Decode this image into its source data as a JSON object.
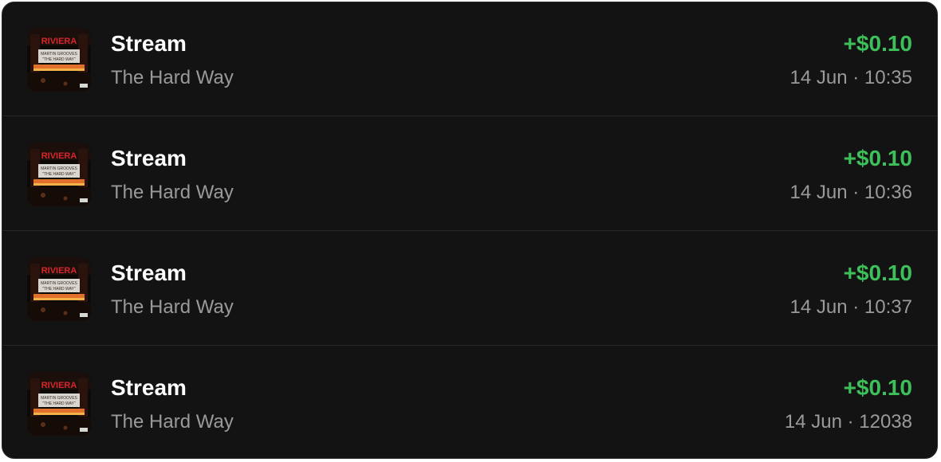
{
  "transactions": [
    {
      "title": "Stream",
      "subtitle": "The Hard Way",
      "amount": "+$0.10",
      "time": "14 Jun · 10:35",
      "artwork": {
        "marquee_top": "RIVIERA",
        "line1": "MARTIN GROOVES",
        "line2": "\"THE HARD WAY\""
      }
    },
    {
      "title": "Stream",
      "subtitle": "The Hard Way",
      "amount": "+$0.10",
      "time": "14 Jun · 10:36",
      "artwork": {
        "marquee_top": "RIVIERA",
        "line1": "MARTIN GROOVES",
        "line2": "\"THE HARD WAY\""
      }
    },
    {
      "title": "Stream",
      "subtitle": "The Hard Way",
      "amount": "+$0.10",
      "time": "14 Jun · 10:37",
      "artwork": {
        "marquee_top": "RIVIERA",
        "line1": "MARTIN GROOVES",
        "line2": "\"THE HARD WAY\""
      }
    },
    {
      "title": "Stream",
      "subtitle": "The Hard Way",
      "amount": "+$0.10",
      "time": "14 Jun · 12038",
      "artwork": {
        "marquee_top": "RIVIERA",
        "line1": "MARTIN GROOVES",
        "line2": "\"THE HARD WAY\""
      }
    }
  ],
  "colors": {
    "card_background": "#131313",
    "divider": "#262626",
    "title": "#ffffff",
    "secondary_text": "#9a9a9a",
    "positive_amount": "#3cc15a",
    "marquee_red": "#d8262a"
  },
  "icons": {
    "artwork": "album-art-theater-marquee"
  }
}
